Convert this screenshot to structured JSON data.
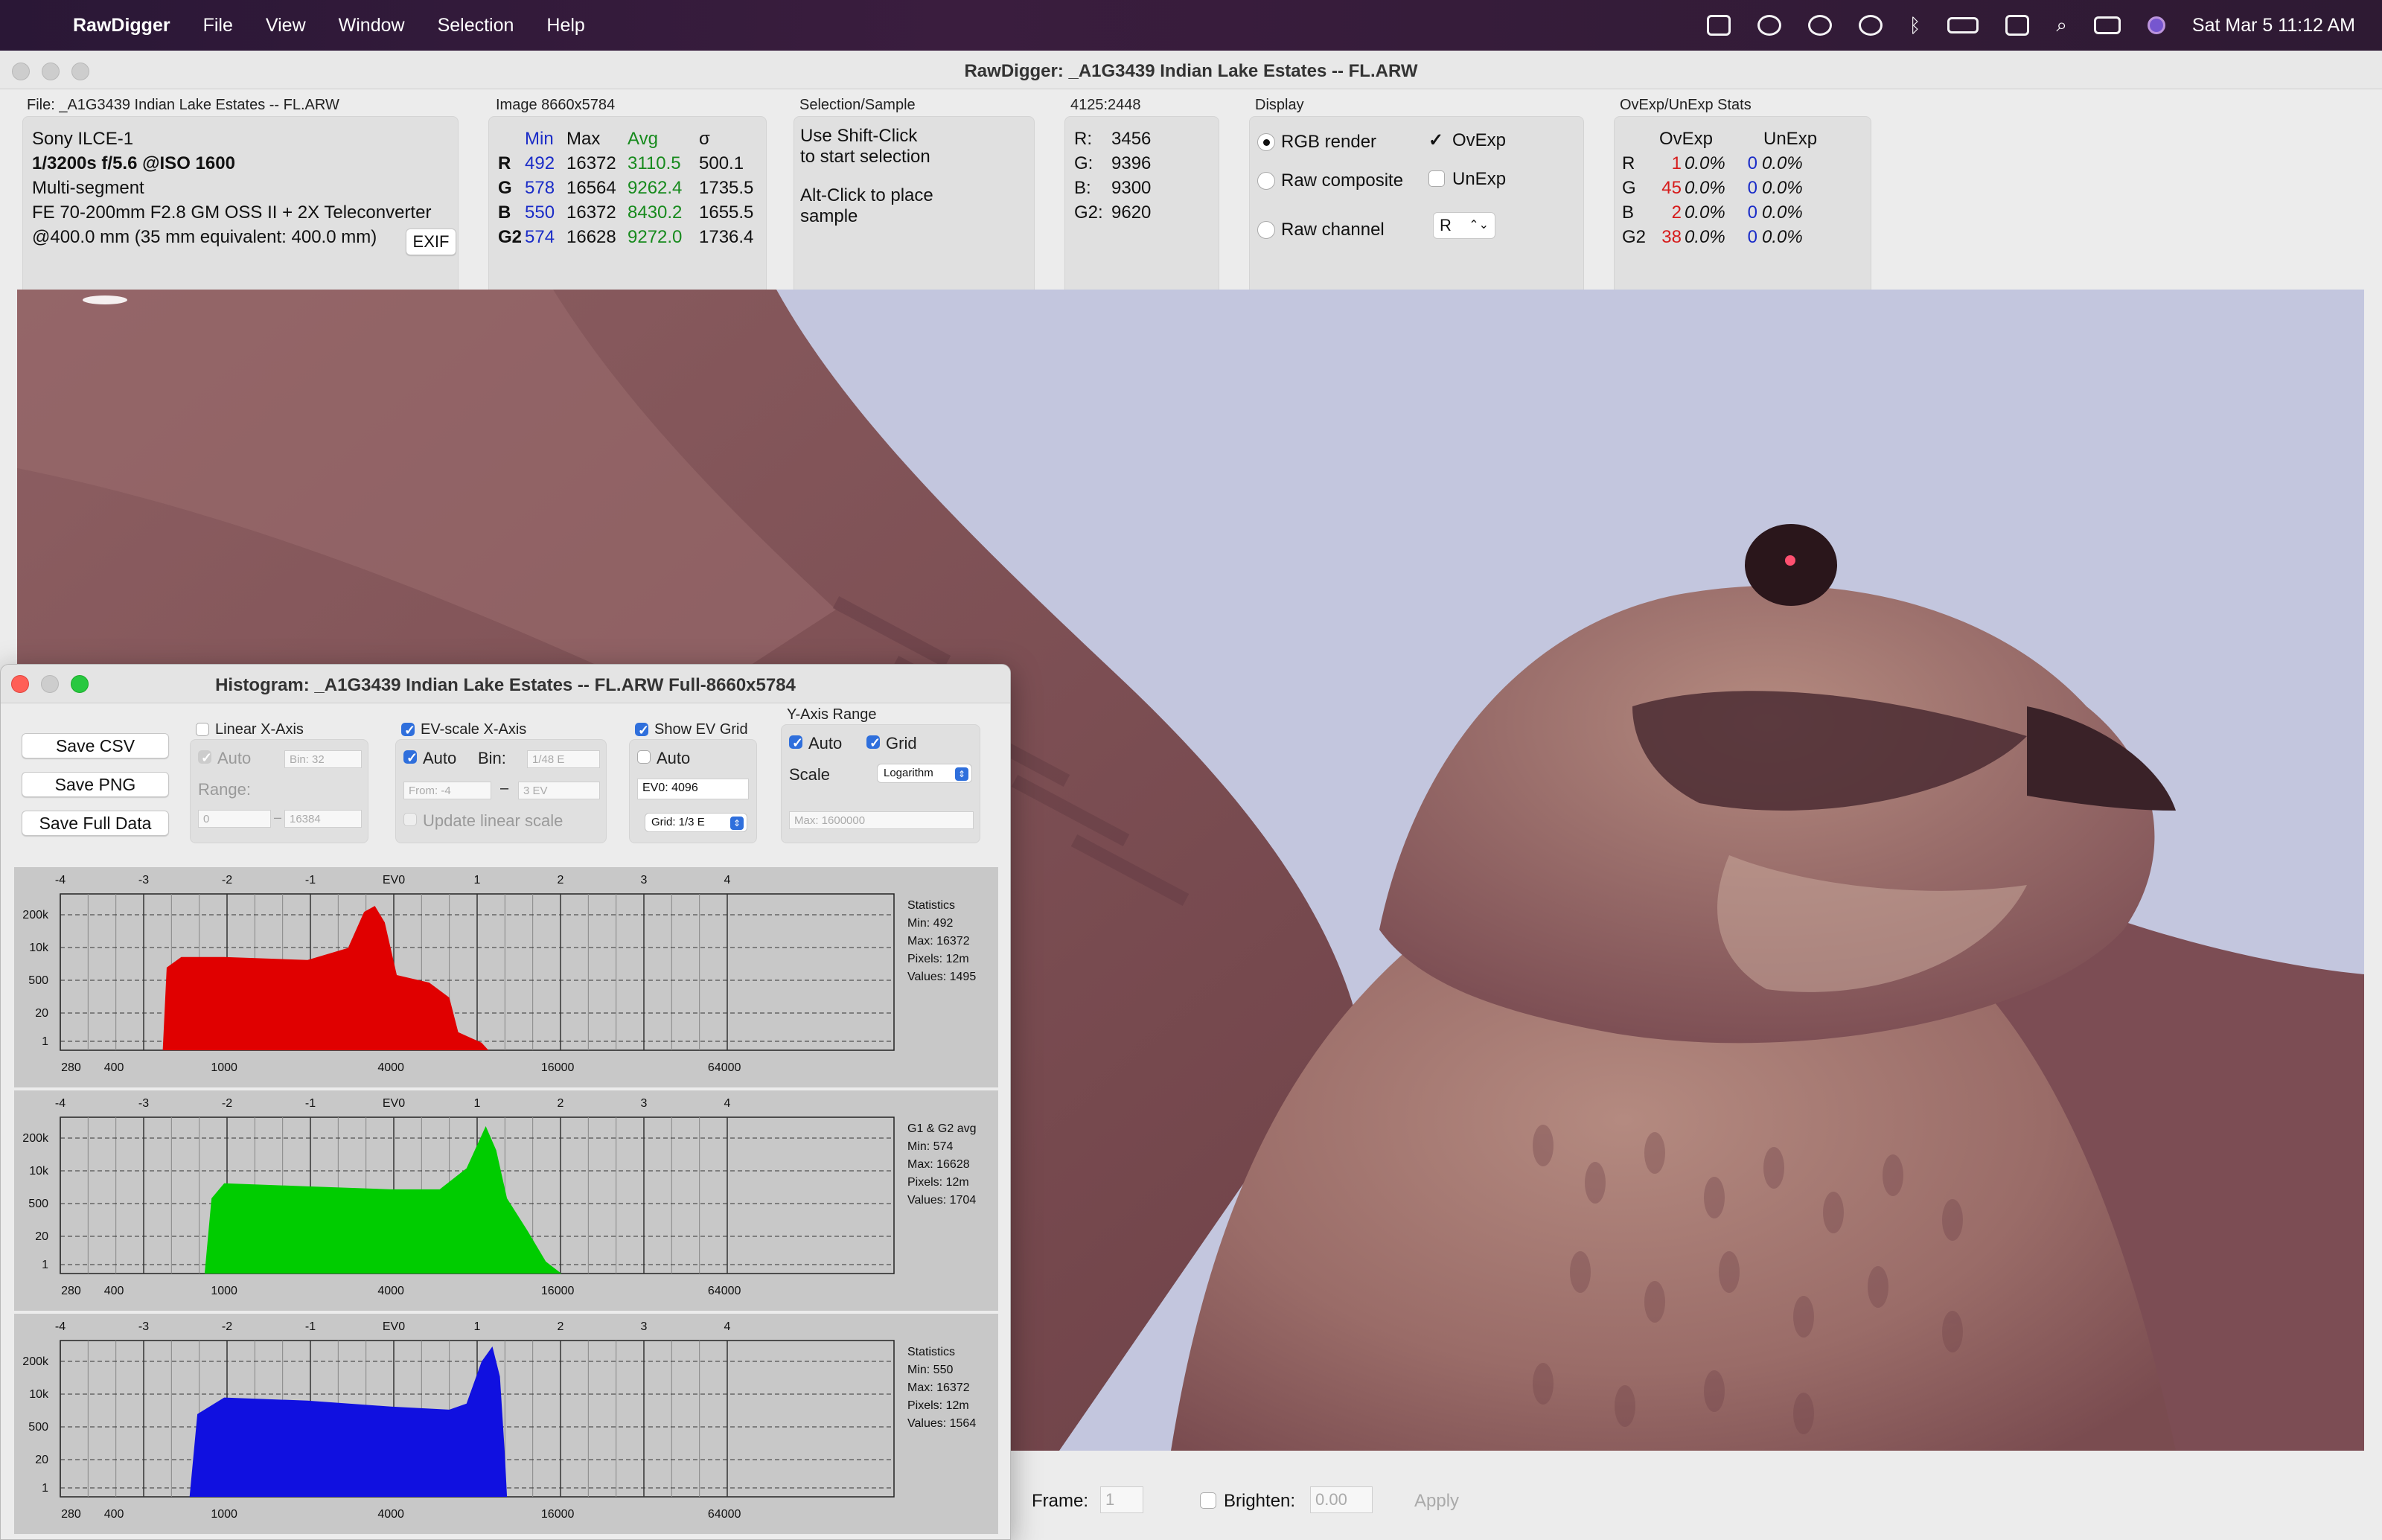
{
  "menubar": {
    "app": "RawDigger",
    "items": [
      "File",
      "View",
      "Window",
      "Selection",
      "Help"
    ],
    "clock": "Sat Mar 5  11:12 AM"
  },
  "window": {
    "title": "RawDigger: _A1G3439 Indian Lake Estates -- FL.ARW"
  },
  "file_panel": {
    "label": "File: _A1G3439 Indian Lake Estates -- FL.ARW",
    "camera": "Sony ILCE-1",
    "exposure": "1/3200s f/5.6 @ISO 1600",
    "metering": "Multi-segment",
    "lens": "FE 70-200mm F2.8 GM OSS II + 2X Teleconverter",
    "focal": "@400.0 mm (35 mm equivalent: 400.0 mm)",
    "exif_button": "EXIF"
  },
  "image_panel": {
    "label": "Image 8660x5784",
    "headers": [
      "Min",
      "Max",
      "Avg",
      "σ"
    ],
    "rows": [
      {
        "ch": "R",
        "min": "492",
        "max": "16372",
        "avg": "3110.5",
        "sd": "500.1"
      },
      {
        "ch": "G",
        "min": "578",
        "max": "16564",
        "avg": "9262.4",
        "sd": "1735.5"
      },
      {
        "ch": "B",
        "min": "550",
        "max": "16372",
        "avg": "8430.2",
        "sd": "1655.5"
      },
      {
        "ch": "G2",
        "min": "574",
        "max": "16628",
        "avg": "9272.0",
        "sd": "1736.4"
      }
    ]
  },
  "selection_panel": {
    "label": "Selection/Sample",
    "line1": "Use Shift-Click",
    "line2": "to start selection",
    "line3": "Alt-Click to place",
    "line4": "sample"
  },
  "pixel_panel": {
    "label": "4125:2448",
    "r_label": "R:",
    "r": "3456",
    "g_label": "G:",
    "g": "9396",
    "b_label": "B:",
    "b": "9300",
    "g2_label": "G2:",
    "g2": "9620"
  },
  "display_panel": {
    "label": "Display",
    "rgb_render": "RGB render",
    "raw_composite": "Raw composite",
    "raw_channel": "Raw channel",
    "ovexp": "OvExp",
    "unexp": "UnExp",
    "channel_select": "R"
  },
  "ovexp_panel": {
    "label": "OvExp/UnExp Stats",
    "headers": [
      "OvExp",
      "UnExp"
    ],
    "rows": [
      {
        "ch": "R",
        "ov_n": "1",
        "ov_p": "0.0%",
        "un_n": "0",
        "un_p": "0.0%"
      },
      {
        "ch": "G",
        "ov_n": "45",
        "ov_p": "0.0%",
        "un_n": "0",
        "un_p": "0.0%"
      },
      {
        "ch": "B",
        "ov_n": "2",
        "ov_p": "0.0%",
        "un_n": "0",
        "un_p": "0.0%"
      },
      {
        "ch": "G2",
        "ov_n": "38",
        "ov_p": "0.0%",
        "un_n": "0",
        "un_p": "0.0%"
      }
    ]
  },
  "bottom": {
    "frame_label": "Frame:",
    "frame_value": "1",
    "brighten_label": "Brighten:",
    "brighten_value": "0.00",
    "apply": "Apply"
  },
  "histogram": {
    "title": "Histogram: _A1G3439 Indian Lake Estates -- FL.ARW Full-8660x5784",
    "save_csv": "Save CSV",
    "save_png": "Save PNG",
    "save_full": "Save Full Data",
    "linear_x": "Linear X-Axis",
    "linear_auto": "Auto",
    "linear_bin": "Bin: 32",
    "range_label": "Range:",
    "range_from": "0",
    "range_dash": "–",
    "range_to": "16384",
    "ev_x": "EV-scale X-Axis",
    "ev_auto": "Auto",
    "ev_bin_label": "Bin:",
    "ev_bin": "1/48 E",
    "ev_from": "From: -4",
    "ev_dash": "–",
    "ev_to": "3 EV",
    "update_linear": "Update linear scale",
    "show_ev_grid": "Show EV Grid",
    "ev_grid_auto": "Auto",
    "ev0_field": "EV0: 4096",
    "grid_popup": "Grid: 1/3 E",
    "y_range": "Y-Axis Range",
    "y_auto": "Auto",
    "y_grid": "Grid",
    "scale_label": "Scale",
    "scale_popup": "Logarithm",
    "y_max": "Max: 1600000",
    "ev_ticks": [
      "-4",
      "-3",
      "-2",
      "-1",
      "EV0",
      "1",
      "2",
      "3",
      "4"
    ],
    "y_ticks": [
      "200k",
      "10k",
      "500",
      "20",
      "1"
    ],
    "x_ticks": [
      "280",
      "400",
      "1000",
      "4000",
      "16000",
      "64000"
    ],
    "stats": [
      {
        "l1": "Statistics",
        "min": "Min: 492",
        "max": "Max: 16372",
        "pixels": "Pixels: 12m",
        "values": "Values: 1495"
      },
      {
        "l1": "G1 & G2 avg",
        "min": "Min: 574",
        "max": "Max: 16628",
        "pixels": "Pixels: 12m",
        "values": "Values: 1704"
      },
      {
        "l1": "Statistics",
        "min": "Min: 550",
        "max": "Max: 16372",
        "pixels": "Pixels: 12m",
        "values": "Values: 1564"
      }
    ],
    "colors": {
      "red": "#e00000",
      "green": "#00cc00",
      "blue": "#1010e0"
    }
  }
}
